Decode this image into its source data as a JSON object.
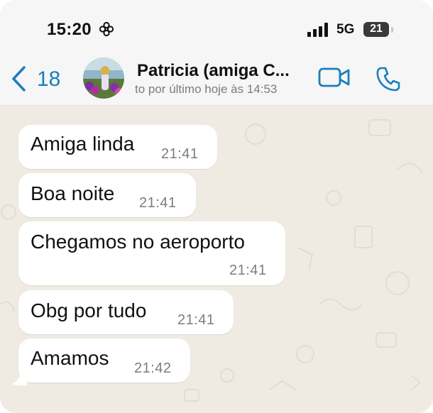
{
  "status_bar": {
    "time": "15:20",
    "flower_icon": "flower-icon",
    "network": "5G",
    "battery": "21"
  },
  "header": {
    "back_count": "18",
    "contact_name": "Patricia (amiga C...",
    "contact_status": "to por último hoje às 14:53"
  },
  "colors": {
    "accent": "#1a7fb9",
    "chat_bg": "#efeae2",
    "bubble": "#ffffff"
  },
  "messages": [
    {
      "text": "Amiga linda",
      "time": "21:41"
    },
    {
      "text": "Boa noite",
      "time": "21:41"
    },
    {
      "text": "Chegamos no aeroporto",
      "time": "21:41"
    },
    {
      "text": "Obg por tudo",
      "time": "21:41"
    },
    {
      "text": "Amamos",
      "time": "21:42"
    }
  ]
}
